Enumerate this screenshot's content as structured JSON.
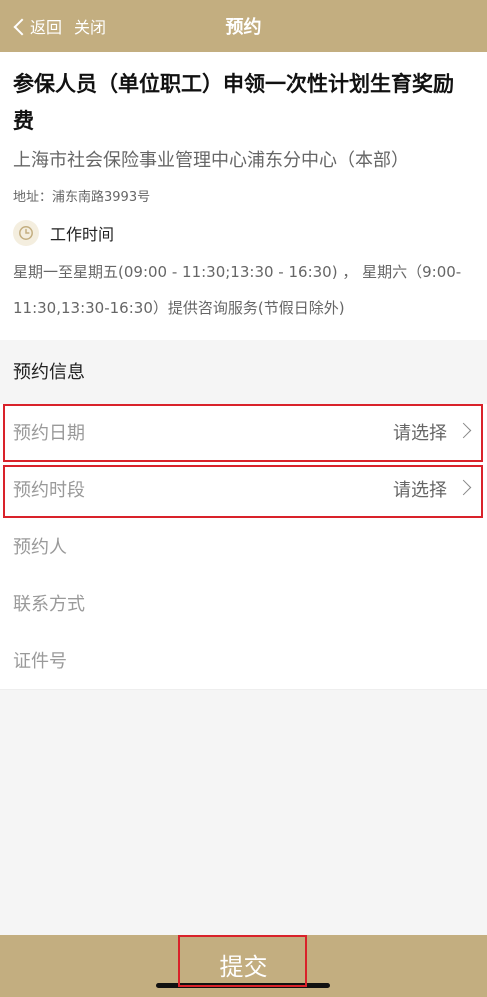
{
  "nav": {
    "back": "返回",
    "close": "关闭",
    "title": "预约"
  },
  "service": {
    "title": "参保人员（单位职工）申领一次性计划生育奖励费",
    "agency": "上海市社会保险事业管理中心浦东分中心（本部）",
    "address": "地址：浦东南路3993号",
    "work_hours_label": "工作时间",
    "work_hours": "星期一至星期五(09:00 - 11:30;13:30 - 16:30) ， 星期六（9:00-11:30,13:30-16:30）提供咨询服务(节假日除外)"
  },
  "form": {
    "section_title": "预约信息",
    "fields": [
      {
        "label": "预约日期",
        "value": "请选择"
      },
      {
        "label": "预约时段",
        "value": "请选择"
      },
      {
        "label": "预约人"
      },
      {
        "label": "联系方式"
      },
      {
        "label": "证件号"
      }
    ]
  },
  "submit": {
    "label": "提交"
  },
  "colors": {
    "theme": "#c3ae80",
    "highlight": "#d9222a",
    "background": "#f5f5f5"
  },
  "icons": {
    "back": "chevron-left-icon",
    "clock": "clock-icon",
    "row_arrow": "chevron-right-icon"
  }
}
